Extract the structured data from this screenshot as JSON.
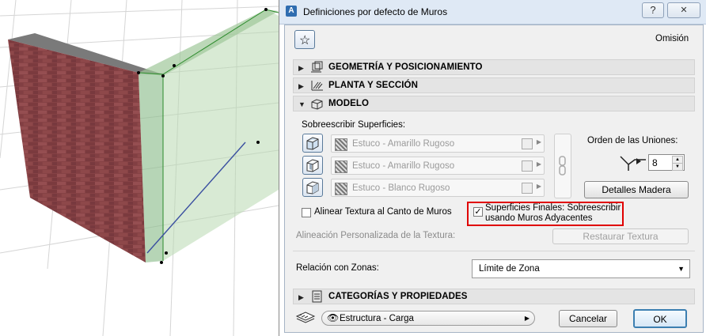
{
  "window": {
    "title": "Definiciones por defecto de Muros",
    "help_label": "?",
    "close_label": "✕"
  },
  "header": {
    "favorites_icon": "star-icon",
    "default_label": "Omisión"
  },
  "sections": [
    {
      "label": "GEOMETRÍA Y POSICIONAMIENTO",
      "expanded": false,
      "icon": "geometry-icon"
    },
    {
      "label": "PLANTA Y SECCIÓN",
      "expanded": false,
      "icon": "plan-section-icon"
    },
    {
      "label": "MODELO",
      "expanded": true,
      "icon": "model-icon"
    },
    {
      "label": "CATEGORÍAS Y PROPIEDADES",
      "expanded": false,
      "icon": "categories-icon"
    }
  ],
  "model": {
    "override_surfaces_label": "Sobreescribir Superficies:",
    "surfaces": [
      {
        "name": "Estuco - Amarillo Rugoso"
      },
      {
        "name": "Estuco - Amarillo Rugoso"
      },
      {
        "name": "Estuco - Blanco Rugoso"
      }
    ],
    "junction_order_label": "Orden de las Uniones:",
    "junction_order_value": "8",
    "timber_details_label": "Detalles Madera",
    "align_texture_label": "Alinear Textura al Canto de Muros",
    "align_texture_checked": false,
    "final_surfaces_label_line1": "Superficies Finales: Sobreescribir",
    "final_surfaces_label_line2": "usando Muros Adyacentes",
    "final_surfaces_checked": true,
    "custom_alignment_label": "Alineación Personalizada de la Textura:",
    "restore_texture_label": "Restaurar Textura",
    "zone_relation_label": "Relación con Zonas:",
    "zone_relation_value": "Límite de Zona"
  },
  "footer": {
    "layer_value": "Estructura - Carga",
    "cancel_label": "Cancelar",
    "ok_label": "OK"
  },
  "colors": {
    "highlight": "#e00000",
    "title_bg": "#dfe9f5",
    "ok_border": "#3c7fb1"
  }
}
